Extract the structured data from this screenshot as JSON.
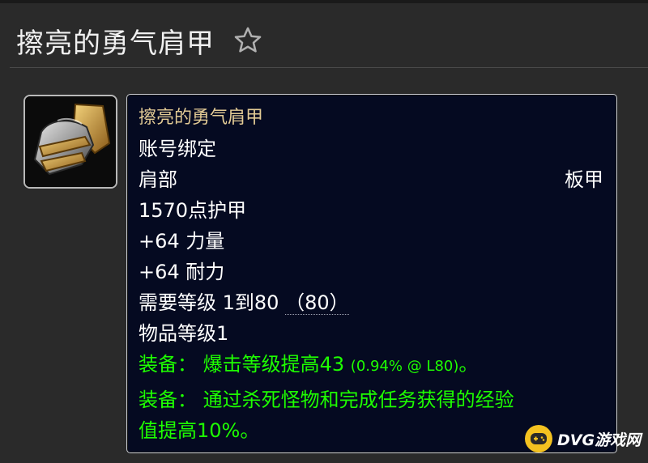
{
  "header": {
    "title": "擦亮的勇气肩甲",
    "favorite_icon": "star-outline-icon"
  },
  "item": {
    "icon": "plate-shoulder-armor-icon",
    "name": "擦亮的勇气肩甲",
    "binding": "账号绑定",
    "slot": "肩部",
    "armor_type": "板甲",
    "armor": "1570点护甲",
    "stat_strength": "+64 力量",
    "stat_stamina": "+64 耐力",
    "required_level_prefix": "需要等级 1到80 ",
    "required_level_current": "（80）",
    "item_level": "物品等级1",
    "equip1_prefix": "装备：  爆击等级提高43 ",
    "equip1_detail": "(0.94% @ L80)",
    "equip1_suffix": "。",
    "equip2_line1": "装备：  通过杀死怪物和完成任务获得的经验",
    "equip2_line2": "值提高10%。"
  },
  "colors": {
    "item_name": "#e3cb95",
    "equip_text": "#1eff00",
    "tooltip_bg": "#050a21",
    "page_bg": "#2a2a2a"
  },
  "watermark": {
    "text": "DVG游戏网",
    "icon": "gamepad-icon"
  }
}
